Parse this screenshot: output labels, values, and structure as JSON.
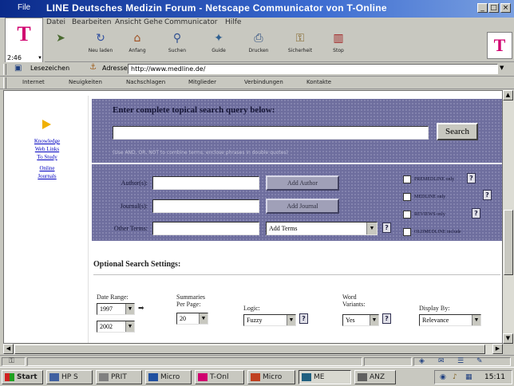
{
  "window": {
    "title": "LINE Deutsches Medizin Forum - Netscape Communicator von T-Online",
    "left_title": "File",
    "controls": [
      "_",
      "□",
      "×"
    ]
  },
  "tonline": {
    "logo_letter": "T",
    "zoom_label": "2:46"
  },
  "menu": [
    "Datei",
    "Bearbeiten",
    "Ansicht",
    "Gehe",
    "Communicator",
    "Hilfe"
  ],
  "toolbar": [
    {
      "label": "Neu laden",
      "icon": "reload-icon"
    },
    {
      "label": "Anfang",
      "icon": "home-icon"
    },
    {
      "label": "Suchen",
      "icon": "search-icon"
    },
    {
      "label": "Guide",
      "icon": "guide-icon"
    },
    {
      "label": "Drucken",
      "icon": "print-icon"
    },
    {
      "label": "Sicherheit",
      "icon": "security-icon"
    },
    {
      "label": "Stop",
      "icon": "stop-icon"
    }
  ],
  "location": {
    "bookmarks_label": "Lesezeichen",
    "address_label": "Adresse:",
    "url": "http://www.medline.de/"
  },
  "personal_toolbar": [
    "Internet",
    "Neuigkeiten",
    "Nachschlagen",
    "Mitglieder",
    "Verbindungen",
    "Kontakte"
  ],
  "sidebar": {
    "links": [
      "Knowledge",
      "Web Links",
      "To Study",
      "Online",
      "Journals"
    ]
  },
  "search": {
    "heading": "Enter complete topical search query below:",
    "button": "Search",
    "hint": "(Use AND, OR, NOT to combine terms; enclose phrases in double quotes)"
  },
  "fields": {
    "author_label": "Author(s):",
    "journal_label": "Journal(s):",
    "other_label": "Other Terms:",
    "add_author": "Add Author",
    "add_journal": "Add Journal",
    "term_select": "Add Terms",
    "checkboxes": [
      "PREMEDLINE only",
      "MEDLINE only",
      "REVIEWS only",
      "OLDMEDLINE include"
    ]
  },
  "options": {
    "heading": "Optional Search Settings:",
    "date_range_label": "Date Range:",
    "date_from": "1997",
    "date_to": "2002",
    "summaries_label": "Summaries Per Page:",
    "summaries_value": "20",
    "logic_label": "Logic:",
    "logic_value": "Fuzzy",
    "word_variants_label": "Word Variants:",
    "word_variants_value": "Yes",
    "display_label": "Display By:",
    "display_value": "Relevance",
    "help": "?"
  },
  "taskbar": {
    "start": "Start",
    "tasks": [
      "HP S",
      "PRIT",
      "Micro",
      "T-Onl",
      "Micro",
      "ME",
      "ANZ"
    ],
    "clock": "15:11"
  }
}
